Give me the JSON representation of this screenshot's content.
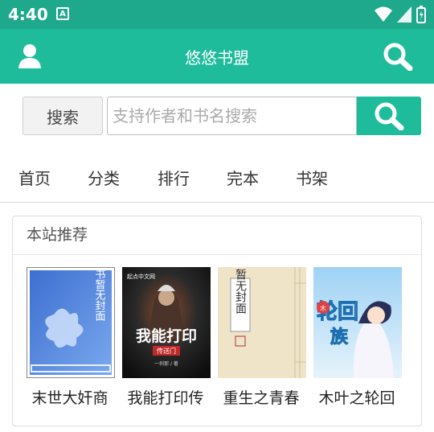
{
  "status": {
    "time": "4:40",
    "notif_letter": "A"
  },
  "header": {
    "title": "悠悠书盟"
  },
  "search": {
    "button_label": "搜索",
    "placeholder": "支持作者和书名搜索"
  },
  "nav": {
    "items": [
      {
        "label": "首页"
      },
      {
        "label": "分类"
      },
      {
        "label": "排行"
      },
      {
        "label": "完本"
      },
      {
        "label": "书架"
      }
    ]
  },
  "recommend": {
    "title": "本站推荐",
    "books": [
      {
        "title": "末世大奸商",
        "cover_text": "此书暂无封面"
      },
      {
        "title": "我能打印传",
        "cover_text": "我能打印",
        "cover_subtext": "传送门",
        "cover_author": "一刹那 / 著",
        "cover_site": "起点中文网"
      },
      {
        "title": "重生之青春",
        "cover_text": "暂无封面"
      },
      {
        "title": "木叶之轮回",
        "cover_text": "轮回族",
        "cover_subtext": "木叶之"
      }
    ]
  },
  "colors": {
    "accent": "#1fbc9c",
    "status_bar": "#1ea88c"
  }
}
